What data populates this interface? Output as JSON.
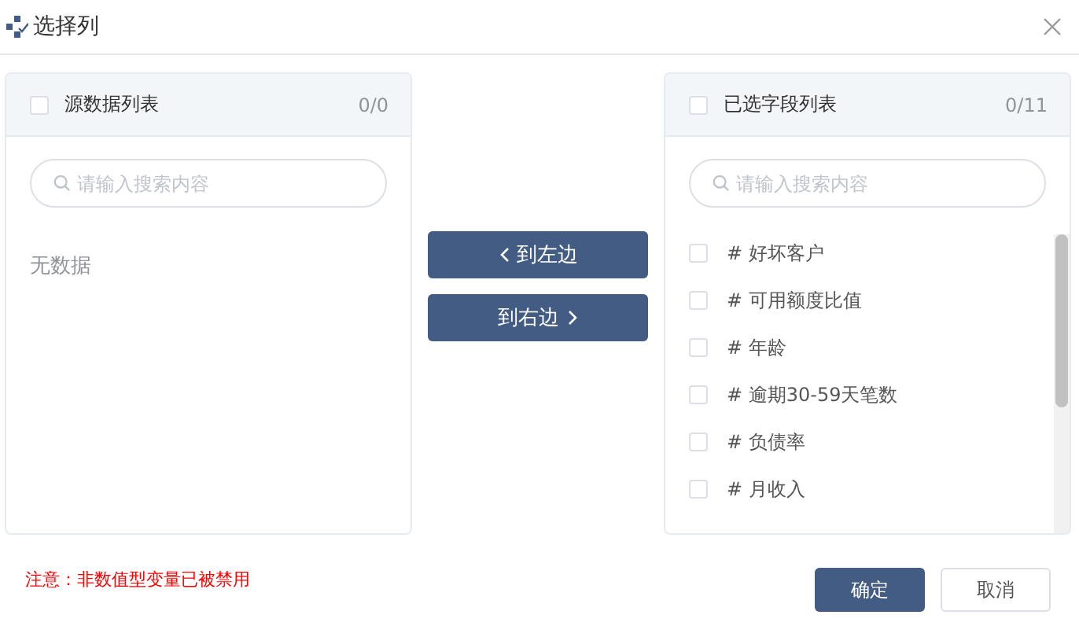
{
  "window": {
    "title": "选择列"
  },
  "source_panel": {
    "title": "源数据列表",
    "checked": false,
    "count": "0/0",
    "search": {
      "placeholder": "请输入搜索内容"
    },
    "empty_text": "无数据"
  },
  "transfer_buttons": [
    {
      "label": "到左边",
      "kind": "left"
    },
    {
      "label": "到右边",
      "kind": "right"
    }
  ],
  "target_panel": {
    "title": "已选字段列表",
    "checked": false,
    "count": "0/11",
    "search": {
      "placeholder": "请输入搜索内容"
    },
    "items": [
      {
        "label": "# 好坏客户",
        "checked": false
      },
      {
        "label": "# 可用额度比值",
        "checked": false
      },
      {
        "label": "# 年龄",
        "checked": false
      },
      {
        "label": "# 逾期30-59天笔数",
        "checked": false
      },
      {
        "label": "# 负债率",
        "checked": false
      },
      {
        "label": "# 月收入",
        "checked": false
      }
    ]
  },
  "note": "注意：非数值型变量已被禁用",
  "buttons": [
    {
      "label": "确定",
      "kind": "primary"
    },
    {
      "label": "取消",
      "kind": "default"
    }
  ]
}
